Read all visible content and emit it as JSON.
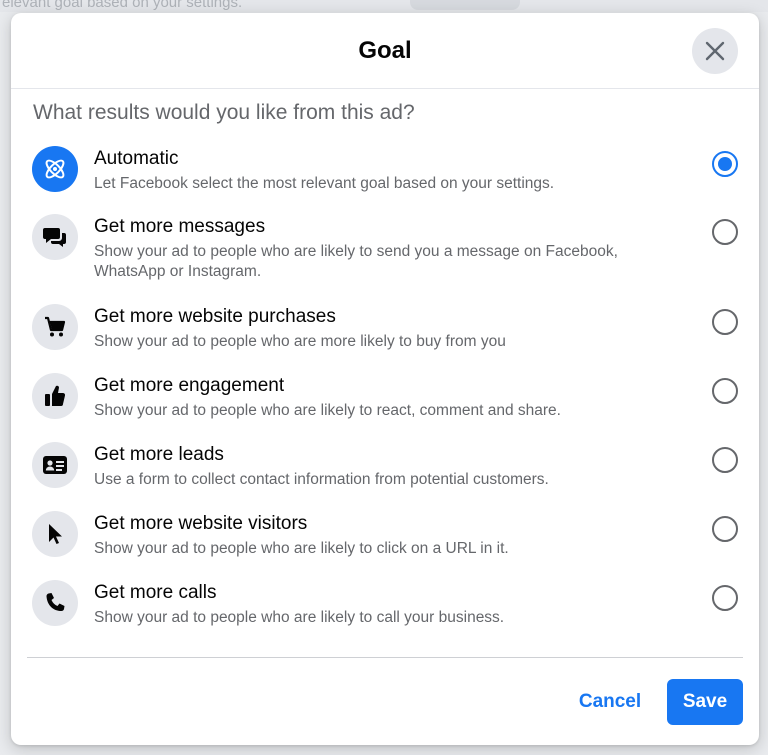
{
  "background": {
    "top_text": "elevant goal based on your settings."
  },
  "dialog": {
    "title": "Goal",
    "question": "What results would you like from this ad?",
    "cancel_label": "Cancel",
    "save_label": "Save",
    "accent_color": "#1877f2",
    "options": [
      {
        "icon": "atom-icon",
        "title": "Automatic",
        "description": "Let Facebook select the most relevant goal based on your settings.",
        "selected": true
      },
      {
        "icon": "chat-bubbles-icon",
        "title": "Get more messages",
        "description": "Show your ad to people who are likely to send you a message on Facebook, WhatsApp or Instagram.",
        "selected": false
      },
      {
        "icon": "shopping-cart-icon",
        "title": "Get more website purchases",
        "description": "Show your ad to people who are more likely to buy from you",
        "selected": false
      },
      {
        "icon": "thumbs-up-icon",
        "title": "Get more engagement",
        "description": "Show your ad to people who are likely to react, comment and share.",
        "selected": false
      },
      {
        "icon": "contact-card-icon",
        "title": "Get more leads",
        "description": "Use a form to collect contact information from potential customers.",
        "selected": false
      },
      {
        "icon": "cursor-icon",
        "title": "Get more website visitors",
        "description": "Show your ad to people who are likely to click on a URL in it.",
        "selected": false
      },
      {
        "icon": "phone-icon",
        "title": "Get more calls",
        "description": "Show your ad to people who are likely to call your business.",
        "selected": false
      }
    ]
  }
}
